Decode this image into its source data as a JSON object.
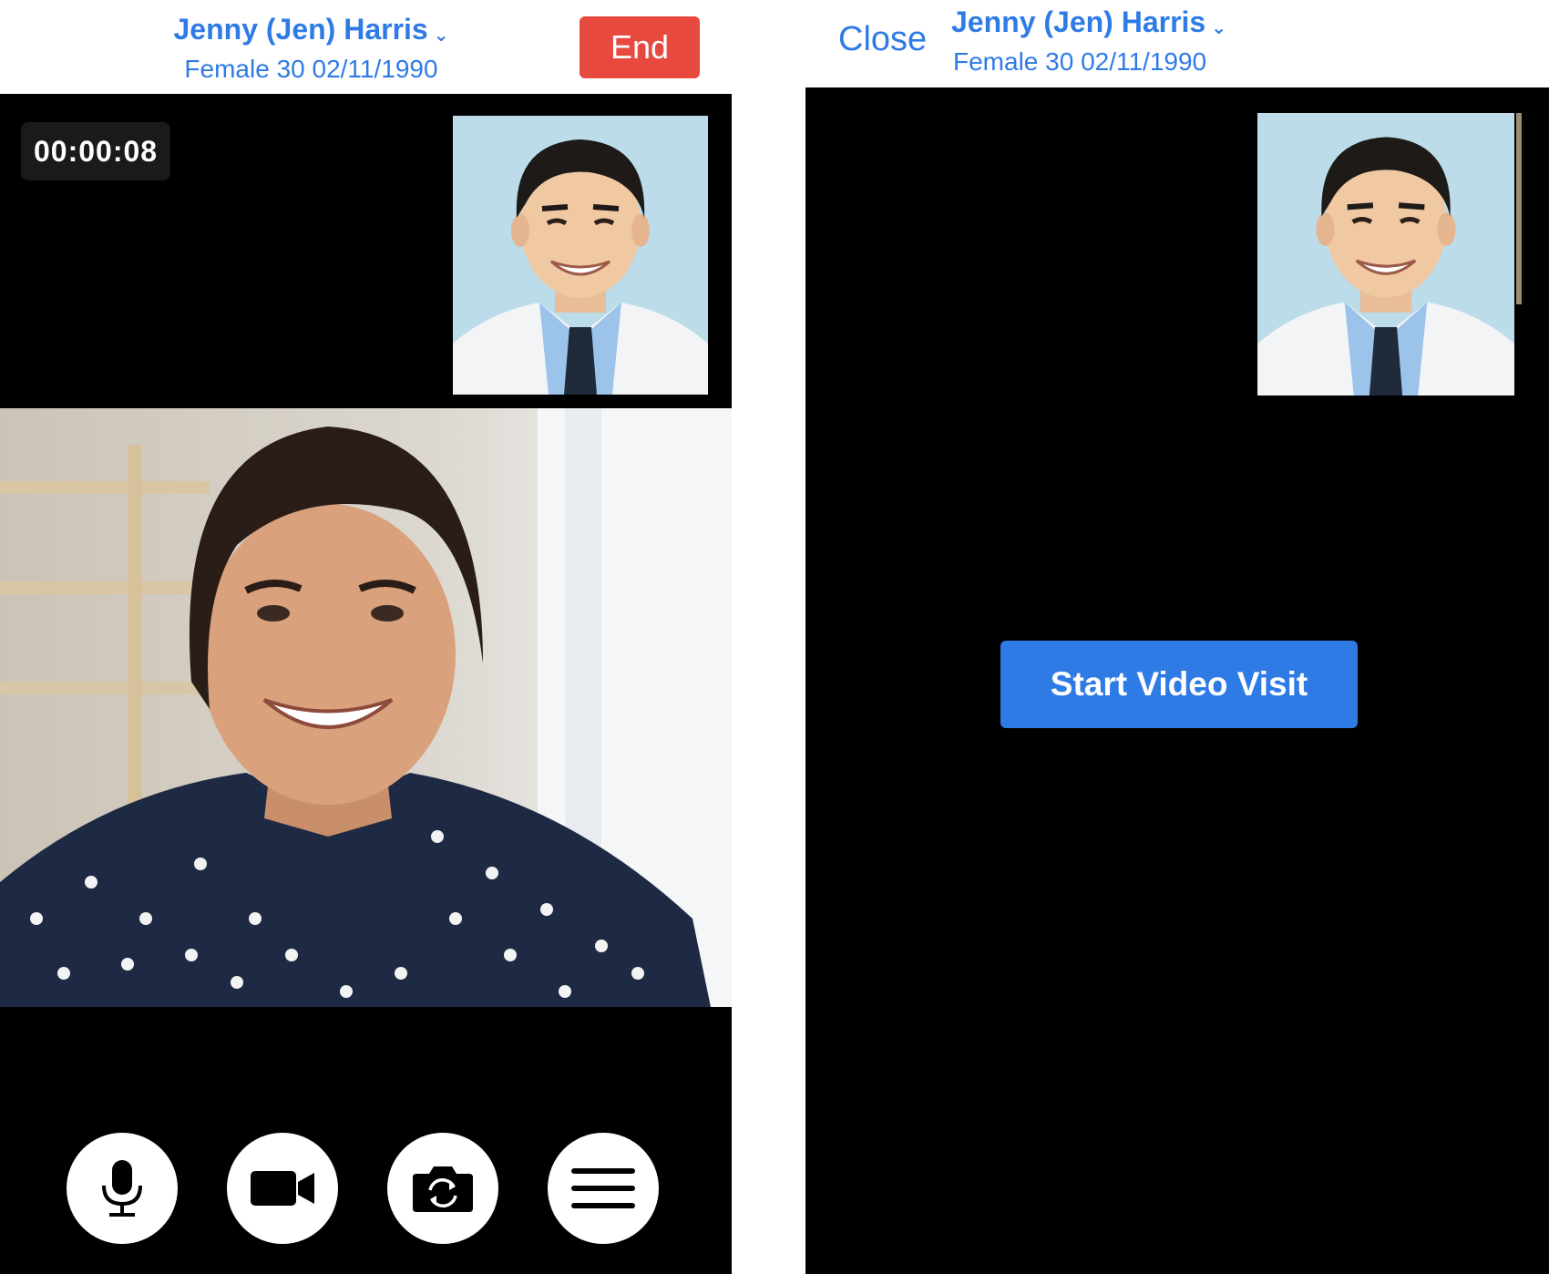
{
  "call_screen": {
    "patient_name": "Jenny (Jen) Harris",
    "patient_details": "Female 30 02/11/1990",
    "end_label": "End",
    "timer": "00:00:08",
    "controls": [
      {
        "icon": "microphone-icon"
      },
      {
        "icon": "video-camera-icon"
      },
      {
        "icon": "switch-camera-icon"
      },
      {
        "icon": "menu-icon"
      }
    ]
  },
  "pre_call_screen": {
    "close_label": "Close",
    "patient_name": "Jenny (Jen) Harris",
    "patient_details": "Female 30 02/11/1990",
    "start_label": "Start Video Visit"
  },
  "colors": {
    "accent_blue": "#2f7be6",
    "end_red": "#e8493f",
    "video_background": "#000000"
  }
}
